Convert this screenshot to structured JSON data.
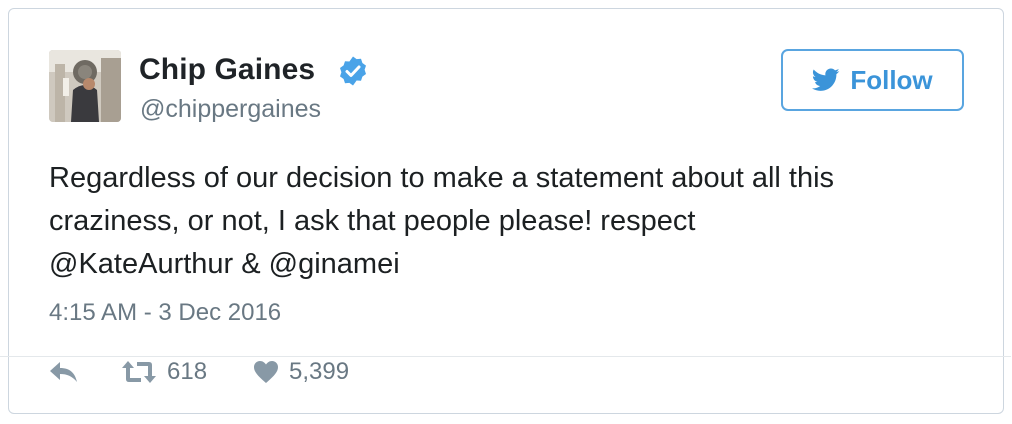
{
  "user": {
    "display_name": "Chip Gaines",
    "handle": "@chippergaines",
    "verified": true,
    "avatar_icon": "profile-photo"
  },
  "follow_button": {
    "label": "Follow",
    "icon": "twitter-bird-icon",
    "color": "#3b94d9"
  },
  "tweet": {
    "lines": [
      "Regardless of our decision to make a statement about all this",
      "craziness, or not, I ask that people please! respect",
      "@KateAurthur & @ginamei"
    ],
    "timestamp": "4:15 AM - 3 Dec 2016"
  },
  "actions": {
    "reply": {
      "icon": "reply-icon"
    },
    "retweet": {
      "icon": "retweet-icon",
      "count": "618"
    },
    "like": {
      "icon": "heart-icon",
      "count": "5,399"
    }
  },
  "colors": {
    "accent": "#3b94d9",
    "verified": "#4aa3e8",
    "muted": "#697883",
    "text": "#1c2022"
  }
}
